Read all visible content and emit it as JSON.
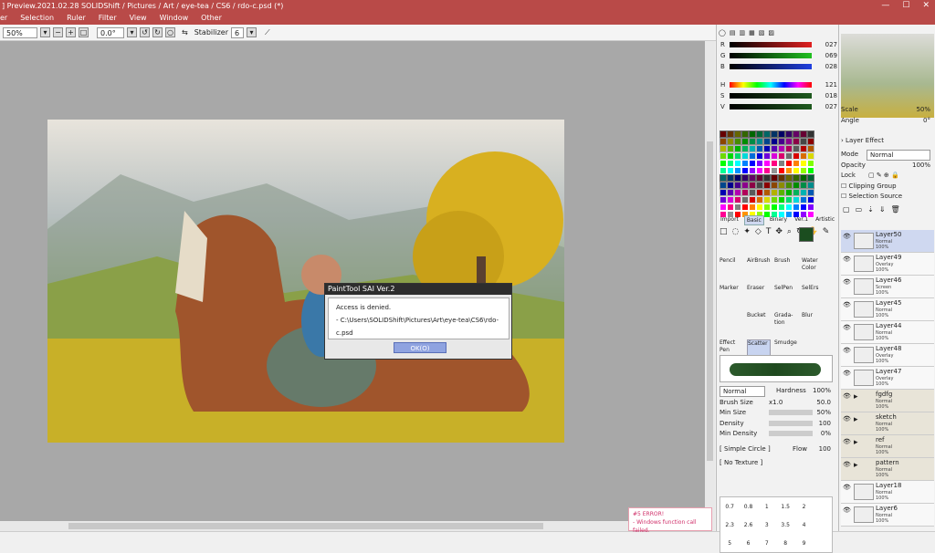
{
  "title": "] Preview.2021.02.28   SOLIDShift / Pictures / Art / eye-tea / CS6 / rdo-c.psd (*)",
  "window_buttons": [
    "—",
    "☐",
    "✕"
  ],
  "menu": [
    "er",
    "Selection",
    "Ruler",
    "Filter",
    "View",
    "Window",
    "Other"
  ],
  "toolbar": {
    "zoom": "50%",
    "angle": "0.0°",
    "stabilizer_label": "Stabilizer",
    "stabilizer_value": "6"
  },
  "dialog": {
    "title": "PaintTool SAI Ver.2",
    "message": "Access is denied.",
    "path": "- C:\\Users\\SOLIDShift\\Pictures\\Art\\eye-tea\\CS6\\rdo-c.psd",
    "ok": "OK(O)"
  },
  "error": {
    "title": "#5 ERROR!",
    "message": "- Windows function call failed."
  },
  "color_sliders": [
    {
      "label": "R",
      "value": "027",
      "color": "#e02020"
    },
    {
      "label": "G",
      "value": "069",
      "color": "#20c020"
    },
    {
      "label": "B",
      "value": "028",
      "color": "#2040e0"
    },
    {
      "label": "H",
      "value": "121",
      "color": "#ff00ff"
    },
    {
      "label": "S",
      "value": "018",
      "color": "#1e5a1e"
    },
    {
      "label": "V",
      "value": "027",
      "color": "#1e5a1e"
    }
  ],
  "tool_tabs": [
    "Import",
    "Basic",
    "Binary",
    "Ver.1",
    "Artistic"
  ],
  "tools": [
    {
      "name": "Pencil"
    },
    {
      "name": "AirBrush"
    },
    {
      "name": "Brush"
    },
    {
      "name": "Water Color"
    },
    {
      "name": "Marker"
    },
    {
      "name": "Eraser"
    },
    {
      "name": "SelPen"
    },
    {
      "name": "SelErs"
    },
    {
      "name": ""
    },
    {
      "name": "Bucket"
    },
    {
      "name": "Grada-tion"
    },
    {
      "name": "Blur"
    },
    {
      "name": "Effect Pen"
    },
    {
      "name": "Scatter"
    },
    {
      "name": "Smudge"
    },
    {
      "name": ""
    }
  ],
  "brush": {
    "mode": "Normal",
    "hardness_label": "Hardness",
    "hardness": "100%",
    "size_label": "Brush Size",
    "size_mult": "x1.0",
    "size": "50.0",
    "min_size_label": "Min Size",
    "min_size": "50%",
    "density_label": "Density",
    "density": "100",
    "min_density_label": "Min Density",
    "min_density": "0%",
    "shape": "[ Simple Circle ]",
    "flow_label": "Flow",
    "flow": "100",
    "texture": "[ No Texture ]"
  },
  "sizes": [
    "0.7",
    "0.8",
    "1",
    "1.5",
    "2",
    "",
    "2.3",
    "2.6",
    "3",
    "3.5",
    "4",
    "",
    "5",
    "6",
    "7",
    "8",
    "9",
    ""
  ],
  "navigator": {
    "scale_label": "Scale",
    "scale": "50%",
    "angle_label": "Angle",
    "angle": "0°"
  },
  "layer_props": {
    "effect": "Layer Effect",
    "mode_label": "Mode",
    "mode": "Normal",
    "opacity_label": "Opacity",
    "opacity": "100%",
    "lock_label": "Lock",
    "clipping": "Clipping Group",
    "selection_source": "Selection Source"
  },
  "layers": [
    {
      "name": "Layer50",
      "mode": "Normal",
      "opacity": "100%",
      "selected": true,
      "folder": false
    },
    {
      "name": "Layer49",
      "mode": "Overlay",
      "opacity": "100%",
      "selected": false,
      "folder": false
    },
    {
      "name": "Layer46",
      "mode": "Screen",
      "opacity": "100%",
      "selected": false,
      "folder": false
    },
    {
      "name": "Layer45",
      "mode": "Normal",
      "opacity": "100%",
      "selected": false,
      "folder": false
    },
    {
      "name": "Layer44",
      "mode": "Normal",
      "opacity": "100%",
      "selected": false,
      "folder": false
    },
    {
      "name": "Layer48",
      "mode": "Overlay",
      "opacity": "100%",
      "selected": false,
      "folder": false
    },
    {
      "name": "Layer47",
      "mode": "Overlay",
      "opacity": "100%",
      "selected": false,
      "folder": false
    },
    {
      "name": "fgdfg",
      "mode": "Normal",
      "opacity": "100%",
      "selected": false,
      "folder": true
    },
    {
      "name": "sketch",
      "mode": "Normal",
      "opacity": "100%",
      "selected": false,
      "folder": true
    },
    {
      "name": "ref",
      "mode": "Normal",
      "opacity": "100%",
      "selected": false,
      "folder": true
    },
    {
      "name": "pattern",
      "mode": "Normal",
      "opacity": "100%",
      "selected": false,
      "folder": true
    },
    {
      "name": "Layer18",
      "mode": "Normal",
      "opacity": "100%",
      "selected": false,
      "folder": false
    },
    {
      "name": "Layer6",
      "mode": "Normal",
      "opacity": "100%",
      "selected": false,
      "folder": false
    }
  ]
}
